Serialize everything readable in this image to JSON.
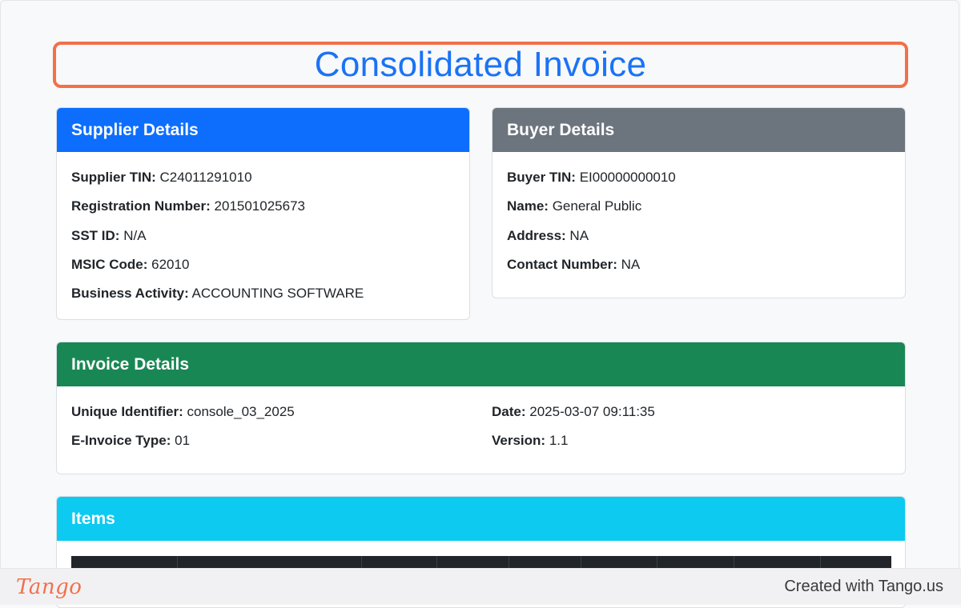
{
  "page_title": "Consolidated Invoice",
  "supplier": {
    "header": "Supplier Details",
    "fields": [
      {
        "label": "Supplier TIN:",
        "value": "C24011291010"
      },
      {
        "label": "Registration Number:",
        "value": "201501025673"
      },
      {
        "label": "SST ID:",
        "value": "N/A"
      },
      {
        "label": "MSIC Code:",
        "value": "62010"
      },
      {
        "label": "Business Activity:",
        "value": "ACCOUNTING SOFTWARE"
      }
    ]
  },
  "buyer": {
    "header": "Buyer Details",
    "fields": [
      {
        "label": "Buyer TIN:",
        "value": "EI00000000010"
      },
      {
        "label": "Name:",
        "value": "General Public"
      },
      {
        "label": "Address:",
        "value": "NA"
      },
      {
        "label": "Contact Number:",
        "value": "NA"
      }
    ]
  },
  "invoice": {
    "header": "Invoice Details",
    "fields": [
      {
        "label": "Unique Identifier:",
        "value": "console_03_2025"
      },
      {
        "label": "Date:",
        "value": "2025-03-07 09:11:35"
      },
      {
        "label": "E-Invoice Type:",
        "value": "01"
      },
      {
        "label": "Version:",
        "value": "1.1"
      }
    ]
  },
  "items": {
    "header": "Items"
  },
  "footer": {
    "logo": "Tango",
    "created_with": "Created with Tango.us"
  },
  "colors": {
    "supplier_header": "#0d6efd",
    "buyer_header": "#6c757d",
    "invoice_header": "#198754",
    "items_header": "#0dcaf0",
    "title": "#1a73f5",
    "highlight": "#f2704a"
  }
}
